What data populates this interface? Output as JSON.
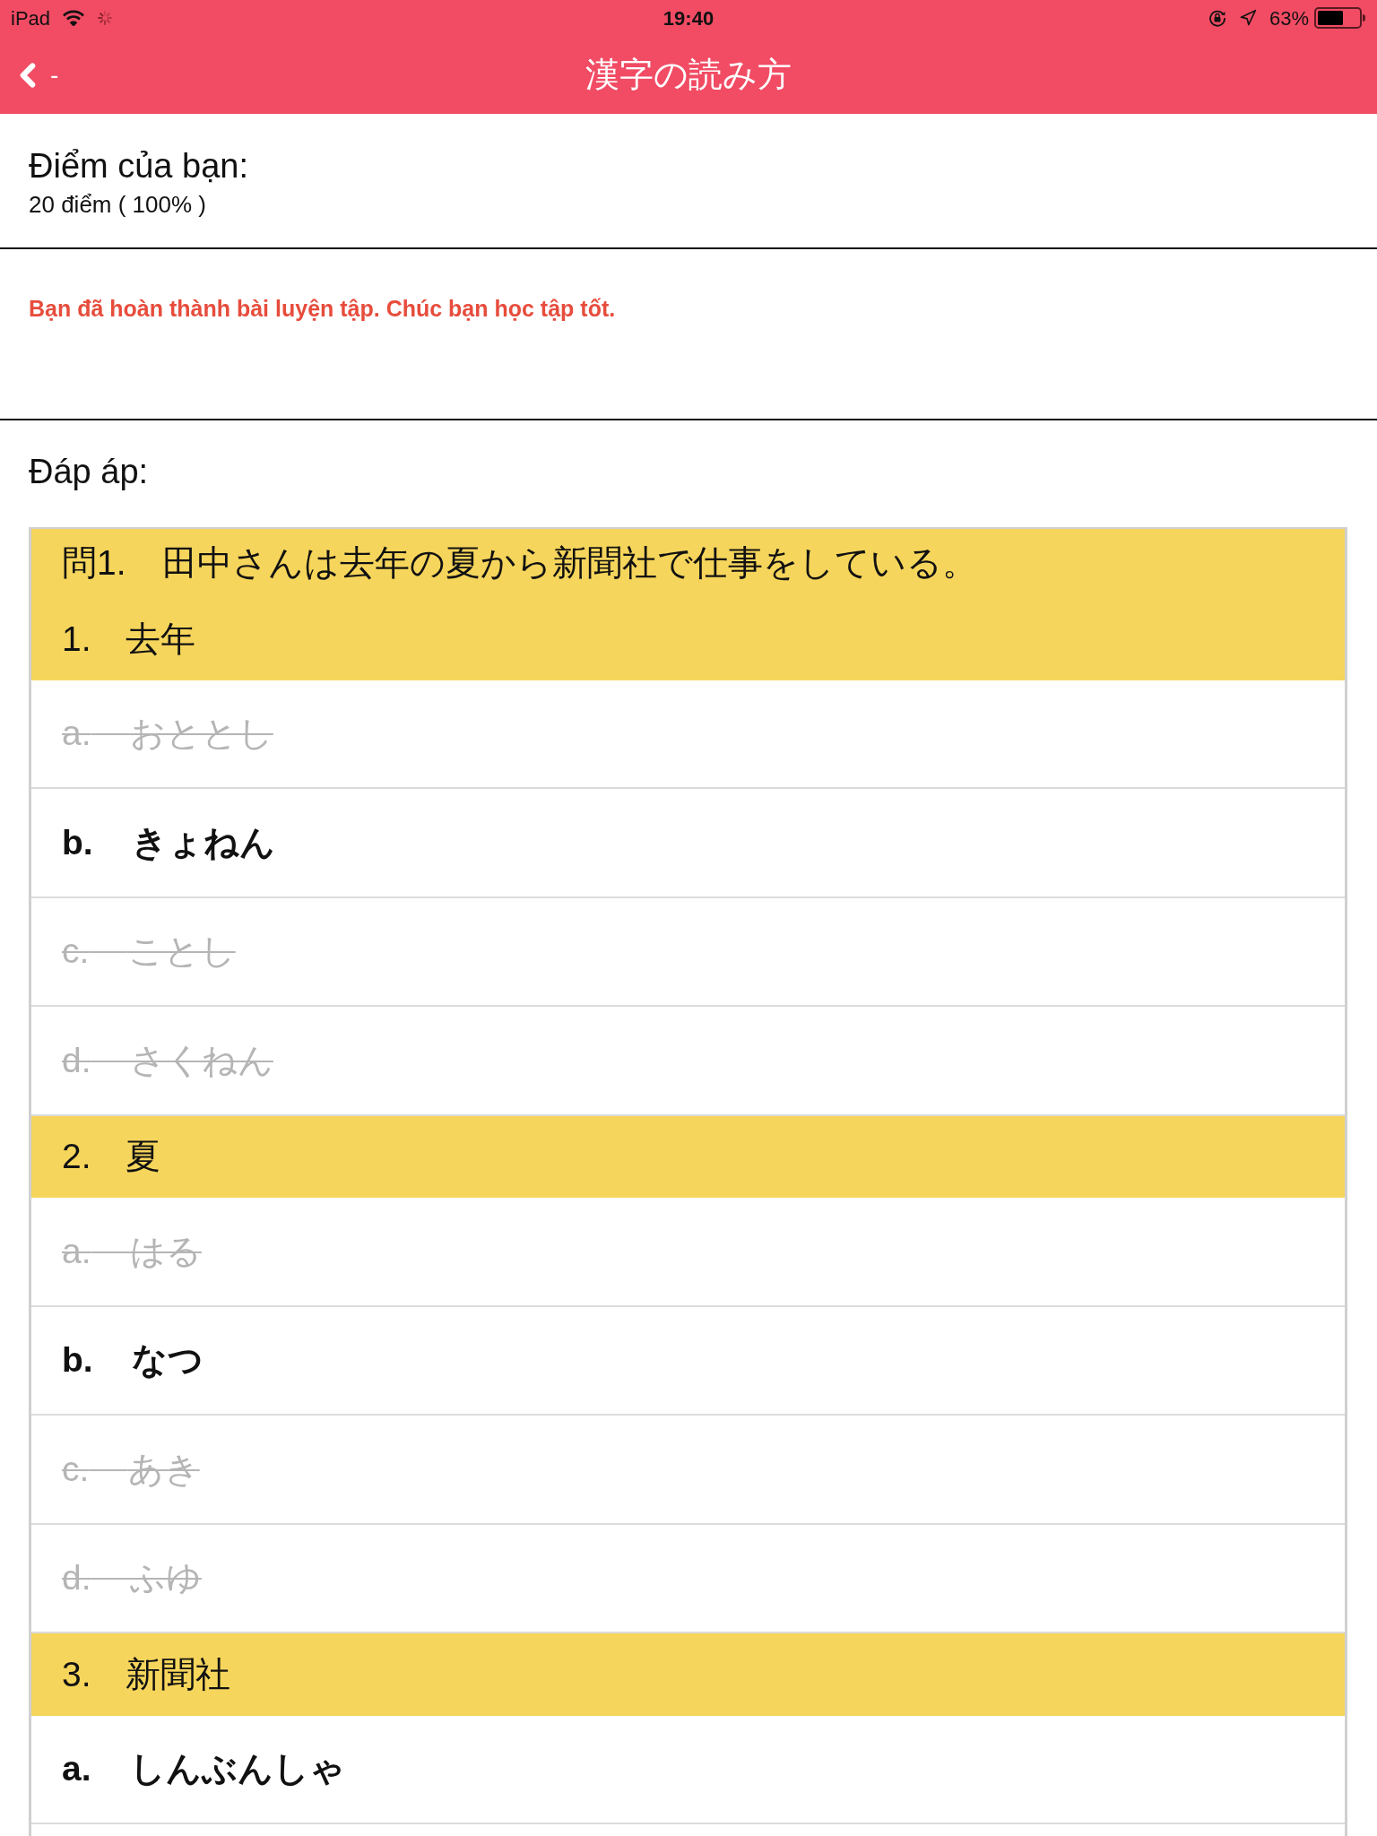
{
  "status_bar": {
    "device": "iPad",
    "time": "19:40",
    "battery": "63%"
  },
  "nav_bar": {
    "back_label": "-",
    "title": "漢字の読み方"
  },
  "score": {
    "label": "Điểm của bạn:",
    "value": "20 điểm ( 100% )"
  },
  "message": "Bạn đã hoàn thành bài luyện tập. Chúc bạn học tập tốt.",
  "answers_heading": "Đáp áp:",
  "questions": [
    {
      "number": "問1.",
      "text": "田中さんは去年の夏から新聞社で仕事をしている。",
      "items": [
        {
          "number": "1.",
          "word": "去年",
          "options": [
            {
              "letter": "a.",
              "text": "おととし",
              "correct": false
            },
            {
              "letter": "b.",
              "text": "きょねん",
              "correct": true
            },
            {
              "letter": "c.",
              "text": "ことし",
              "correct": false
            },
            {
              "letter": "d.",
              "text": "さくねん",
              "correct": false
            }
          ]
        },
        {
          "number": "2.",
          "word": "夏",
          "options": [
            {
              "letter": "a.",
              "text": "はる",
              "correct": false
            },
            {
              "letter": "b.",
              "text": "なつ",
              "correct": true
            },
            {
              "letter": "c.",
              "text": "あき",
              "correct": false
            },
            {
              "letter": "d.",
              "text": "ふゆ",
              "correct": false
            }
          ]
        },
        {
          "number": "3.",
          "word": "新聞社",
          "options": [
            {
              "letter": "a.",
              "text": "しんぶんしゃ",
              "correct": true
            }
          ]
        }
      ]
    }
  ]
}
